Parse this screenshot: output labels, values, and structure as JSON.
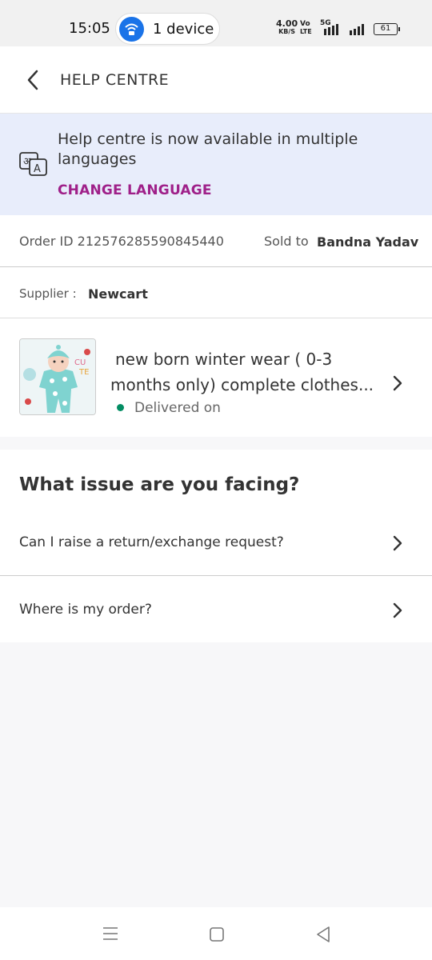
{
  "status_bar": {
    "time": "15:05",
    "hotspot_label": "1 device",
    "net_speed_value": "4.00",
    "net_speed_unit": "KB/S",
    "volte_top": "Vo",
    "volte_bottom": "LTE",
    "network": "5G",
    "battery": "61"
  },
  "header": {
    "title": "HELP CENTRE"
  },
  "language_banner": {
    "message": "Help centre is now available in multiple languages",
    "action": "CHANGE LANGUAGE"
  },
  "order": {
    "order_id": "Order ID 212576285590845440",
    "sold_to_label": "Sold to",
    "sold_to_name": "Bandna Yadav",
    "supplier_label": "Supplier :",
    "supplier_name": "Newcart"
  },
  "product": {
    "title_line1": "new born winter wear ( 0-3",
    "title_line2": "months only) complete clothes...",
    "status": "Delivered on",
    "status_color": "#038d63"
  },
  "issues": {
    "heading": "What issue are you facing?",
    "items": [
      {
        "label": "Can I raise a return/exchange request?"
      },
      {
        "label": "Where is my order?"
      }
    ]
  },
  "colors": {
    "accent": "#9f2089",
    "banner_bg": "#e8edfb"
  },
  "icons": {
    "back": "back-arrow-icon",
    "language": "translate-icon",
    "chevron": "chevron-right-icon",
    "nav_menu": "menu-icon",
    "nav_home": "home-square-icon",
    "nav_back": "back-triangle-icon"
  }
}
